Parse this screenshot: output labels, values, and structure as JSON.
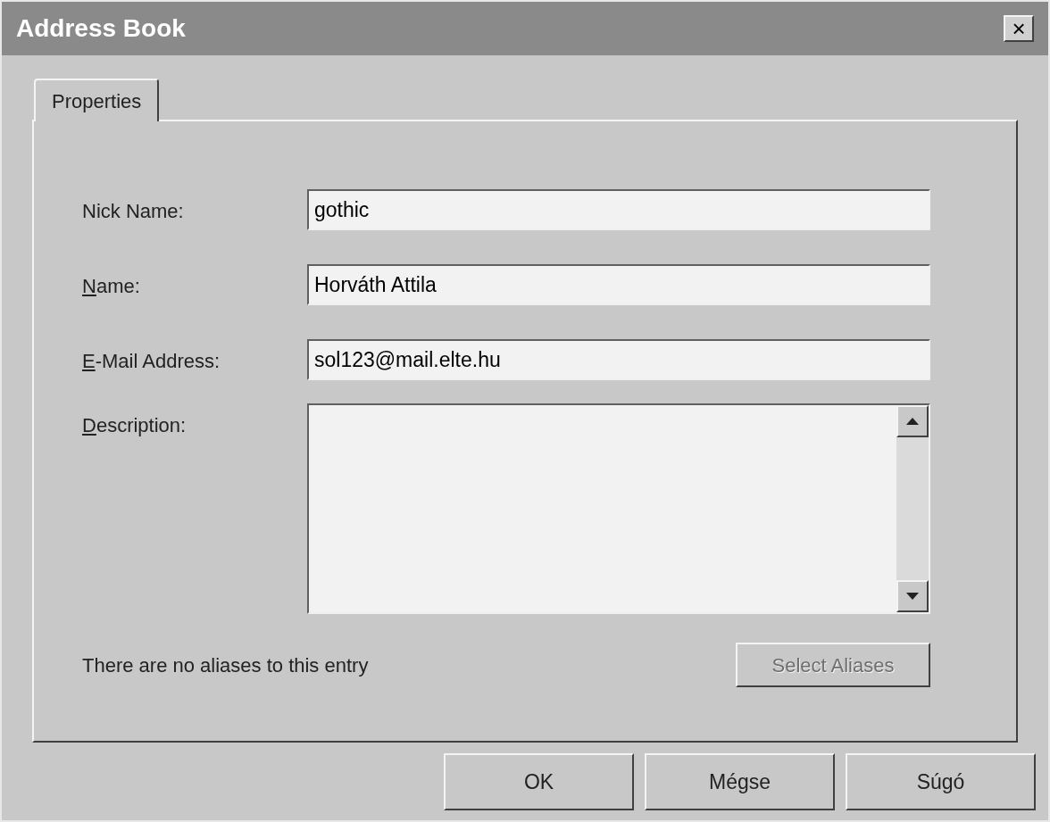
{
  "window": {
    "title": "Address Book",
    "close": "×"
  },
  "tabs": [
    {
      "label": "Properties",
      "selected": true
    }
  ],
  "fields": [
    {
      "kind": "input",
      "label": "Nick Name:",
      "mnemonic": false,
      "value": "gothic"
    },
    {
      "kind": "input",
      "label": "Name:",
      "mnemonic": true,
      "value": "Horváth Attila"
    },
    {
      "kind": "input",
      "label": "E-Mail Address:",
      "mnemonic": true,
      "value": "sol123@mail.elte.hu"
    },
    {
      "kind": "textarea",
      "label": "Description:",
      "mnemonic": true
    }
  ],
  "aliases": {
    "text": "There are no aliases to this entry",
    "button": {
      "label": "Select Aliases",
      "disabled": true
    }
  },
  "buttons": [
    {
      "label": "OK",
      "disabled": false
    },
    {
      "label": "Mégse",
      "disabled": false
    },
    {
      "label": "Súgó",
      "disabled": false
    }
  ]
}
